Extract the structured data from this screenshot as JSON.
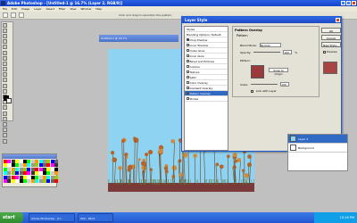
{
  "window": {
    "title": "Adobe Photoshop - [Untitled-1 @ 16.7% (Layer 2, RGB/8)]"
  },
  "menubar": {
    "items": [
      "File",
      "Edit",
      "Image",
      "Layer",
      "Select",
      "Filter",
      "View",
      "Window",
      "Help"
    ]
  },
  "optbar": {
    "hint": "Click and drag to reposition the pattern."
  },
  "document": {
    "title": "Untitled-1 @ 16.7%"
  },
  "dialog": {
    "title": "Layer Style",
    "styles": [
      {
        "label": "Styles",
        "checked": false
      },
      {
        "label": "Blending Options: Default",
        "checked": false
      },
      {
        "label": "Drop Shadow",
        "checked": true
      },
      {
        "label": "Inner Shadow",
        "checked": false
      },
      {
        "label": "Outer Glow",
        "checked": false
      },
      {
        "label": "Inner Glow",
        "checked": false
      },
      {
        "label": "Bevel and Emboss",
        "checked": false
      },
      {
        "label": "Contour",
        "checked": false
      },
      {
        "label": "Texture",
        "checked": false
      },
      {
        "label": "Satin",
        "checked": false
      },
      {
        "label": "Color Overlay",
        "checked": false
      },
      {
        "label": "Gradient Overlay",
        "checked": false
      },
      {
        "label": "Pattern Overlay",
        "checked": true
      },
      {
        "label": "Stroke",
        "checked": false
      }
    ],
    "panel_title": "Pattern Overlay",
    "group_title": "Pattern",
    "blend_label": "Blend Mode:",
    "blend_value": "Normal",
    "opacity_label": "Opacity:",
    "opacity_value": "100",
    "opacity_unit": "%",
    "pattern_label": "Pattern:",
    "snap_label": "Snap to Origin",
    "scale_label": "Scale:",
    "scale_value": "100",
    "link_label": "Link with Layer",
    "buttons": {
      "ok": "OK",
      "cancel": "Cancel",
      "new_style": "New Style...",
      "preview": "Preview"
    }
  },
  "layers": {
    "items": [
      {
        "label": "Layer 2",
        "selected": true
      },
      {
        "label": "Background",
        "selected": false
      }
    ]
  },
  "taskbar": {
    "start": "start",
    "items": [
      "Adobe Photoshop - [U...",
      "002 - Paint"
    ],
    "clock": "10:16 PM"
  },
  "colors": {
    "canvas": "#8fd3f2",
    "accent": "#316ac5",
    "pattern": "#9a3a3a"
  }
}
